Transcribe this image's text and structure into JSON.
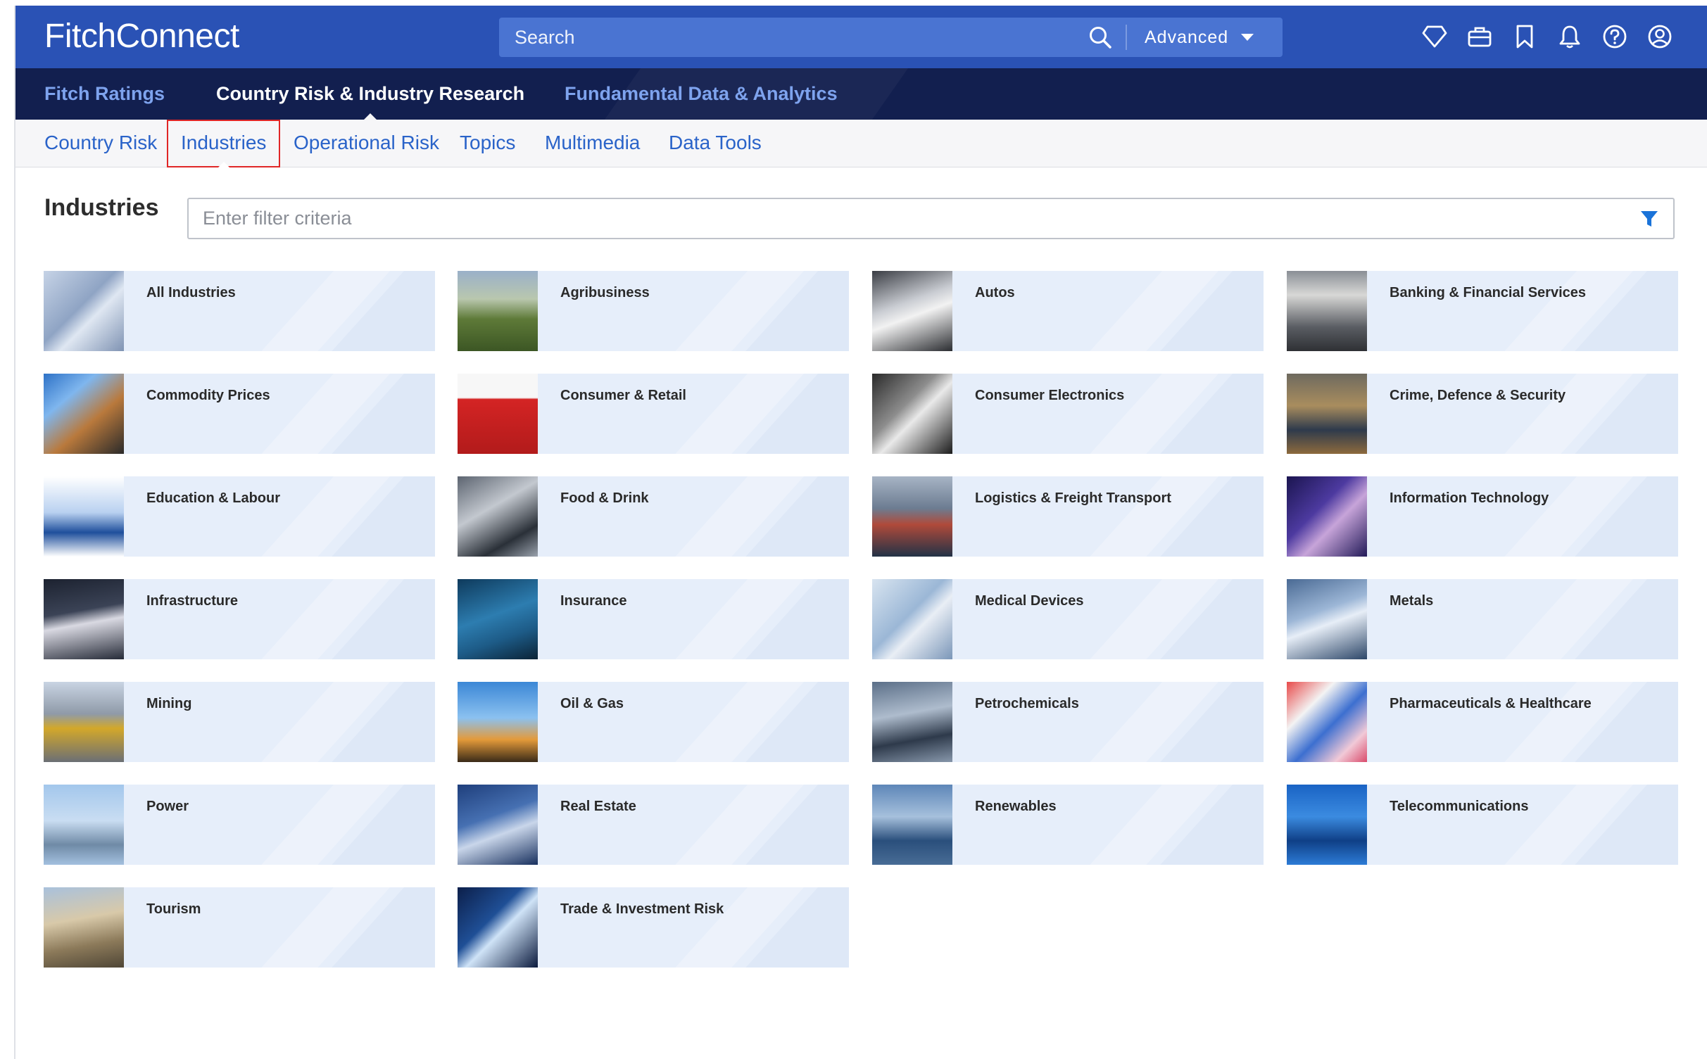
{
  "header": {
    "logo_part1": "Fitch",
    "logo_part2": "Connect",
    "search_placeholder": "Search",
    "advanced_label": "Advanced",
    "icons": [
      "diamond-icon",
      "briefcase-icon",
      "bookmark-icon",
      "bell-icon",
      "help-icon",
      "account-icon"
    ]
  },
  "nav": {
    "tabs": [
      "Fitch Ratings",
      "Country Risk & Industry Research",
      "Fundamental Data & Analytics"
    ],
    "active": "Country Risk & Industry Research"
  },
  "subnav": {
    "tabs": [
      "Country Risk",
      "Industries",
      "Operational Risk",
      "Topics",
      "Multimedia",
      "Data Tools"
    ],
    "selected": "Industries"
  },
  "page": {
    "title": "Industries",
    "filter_placeholder": "Enter filter criteria"
  },
  "industries": [
    "All Industries",
    "Agribusiness",
    "Autos",
    "Banking & Financial Services",
    "Commodity Prices",
    "Consumer & Retail",
    "Consumer Electronics",
    "Crime, Defence & Security",
    "Education & Labour",
    "Food & Drink",
    "Logistics & Freight Transport",
    "Information Technology",
    "Infrastructure",
    "Insurance",
    "Medical Devices",
    "Metals",
    "Mining",
    "Oil & Gas",
    "Petrochemicals",
    "Pharmaceuticals & Healthcare",
    "Power",
    "Real Estate",
    "Renewables",
    "Telecommunications",
    "Tourism",
    "Trade & Investment Risk"
  ],
  "colors": {
    "header_blue": "#2a52b5",
    "nav_navy": "#121f4f",
    "link_blue": "#2a63c9",
    "tile_bg": "#e6eefa",
    "selected_outline": "#e02626"
  }
}
